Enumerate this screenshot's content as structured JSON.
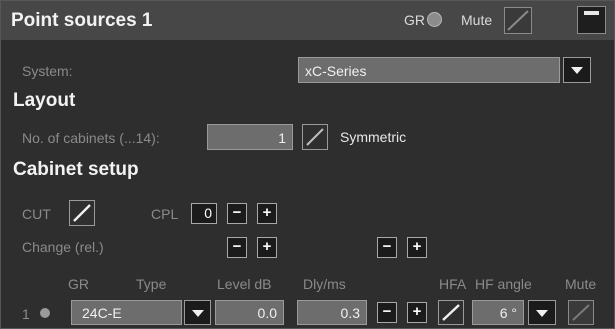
{
  "header": {
    "title": "Point sources 1",
    "gr_label": "GR",
    "mute_label": "Mute"
  },
  "system": {
    "label": "System:",
    "selected": "xC-Series"
  },
  "layout": {
    "section_title": "Layout",
    "cabinets_label": "No. of cabinets (...14):",
    "cabinets_value": "1",
    "symmetric_label": "Symmetric"
  },
  "cabinet_setup": {
    "section_title": "Cabinet setup",
    "cut_label": "CUT",
    "cpl_label": "CPL",
    "cpl_value": "0",
    "change_label": "Change (rel.)",
    "minus": "−",
    "plus": "+",
    "columns": {
      "gr": "GR",
      "type": "Type",
      "level": "Level dB",
      "delay": "Dly/ms",
      "hfa": "HFA",
      "hf_angle": "HF angle",
      "mute": "Mute"
    },
    "rows": [
      {
        "index": "1",
        "type": "24C-E",
        "level": "0.0",
        "delay": "0.3",
        "hf_angle": "6 °"
      }
    ]
  },
  "colors": {
    "header_bg": "#474747",
    "panel_bg": "#2e2e2e",
    "field_bg": "#6d6d6d",
    "button_bg": "#1b1b1b"
  }
}
